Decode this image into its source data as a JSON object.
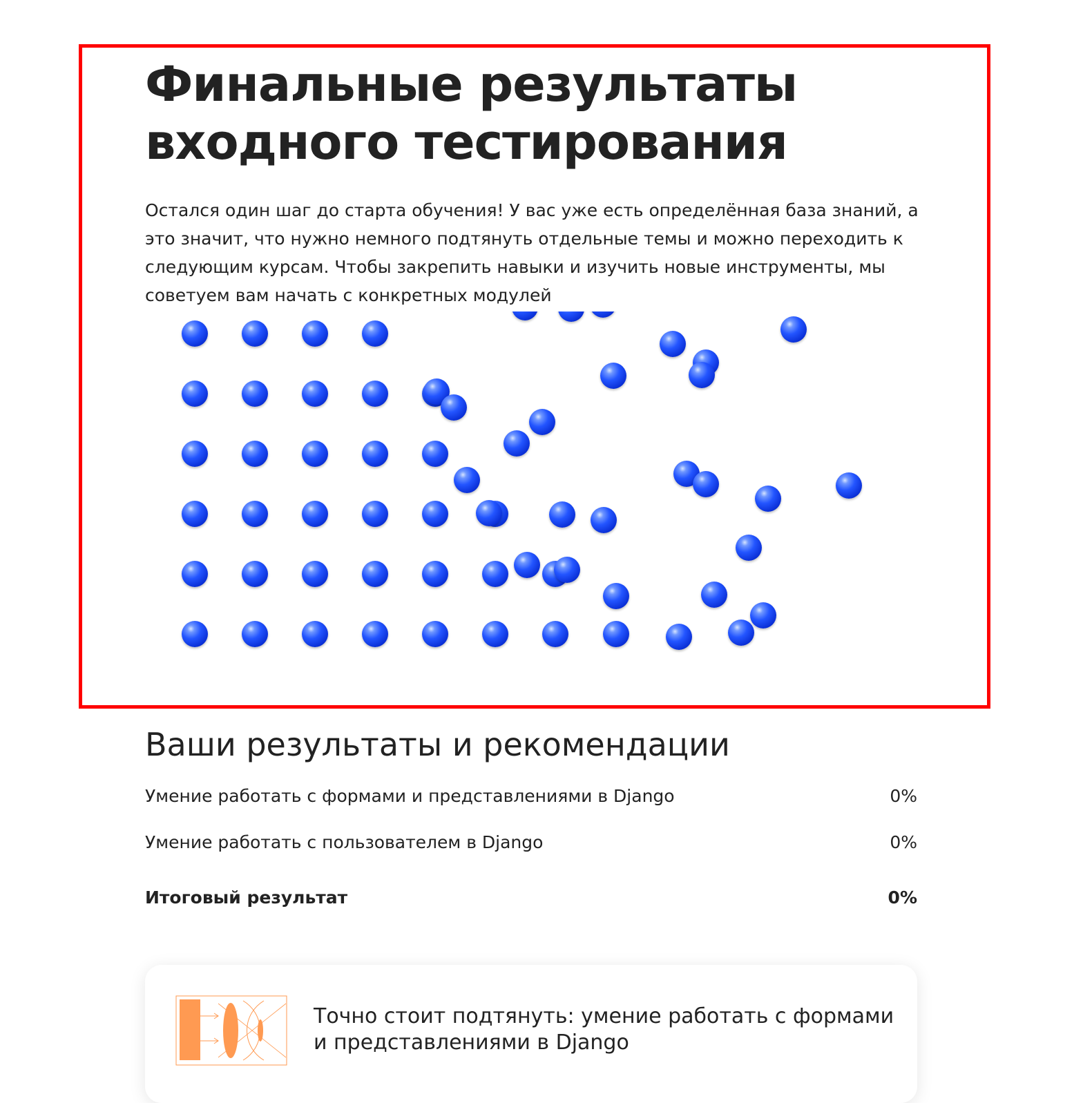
{
  "hero": {
    "title": "Финальные результаты\nвходного тестирования",
    "text": "Остался один шаг до старта обучения! У вас уже есть определённая база знаний, а это значит, что нужно немного подтянуть отдельные темы и можно переходить к следующим курсам. Чтобы закрепить навыки и изучить новые инструменты, мы советуем вам начать с конкретных модулей",
    "frame_color": "#ff0000",
    "ball_color": "#1f4fff"
  },
  "results": {
    "title": "Ваши результаты и рекомендации",
    "items": [
      {
        "label": "Умение работать с формами и представлениями в Django",
        "value": "0%"
      },
      {
        "label": "Умение работать с пользователем в Django",
        "value": "0%"
      }
    ],
    "total": {
      "label": "Итоговый результат",
      "value": "0%"
    }
  },
  "recommendation": {
    "icon": "lens-diagram-icon",
    "icon_color": "#ff9a52",
    "text": "Точно стоит подтянуть: умение работать с формами и представлениями в Django"
  }
}
